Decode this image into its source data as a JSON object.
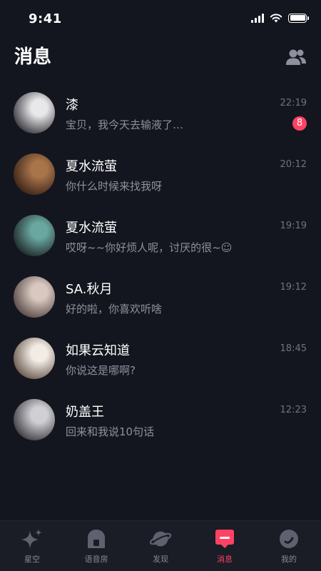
{
  "status": {
    "time": "9:41"
  },
  "header": {
    "title": "消息",
    "contacts_icon": "people-icon"
  },
  "chats": [
    {
      "name": "漆",
      "preview": "宝贝，我今天去输液了…",
      "time": "22:19",
      "unread": "8",
      "avatar_colors": [
        "#e8e8ea",
        "#3a3a40"
      ]
    },
    {
      "name": "夏水流萤",
      "preview": "你什么时候来找我呀",
      "time": "20:12",
      "avatar_colors": [
        "#a8744a",
        "#3c2418"
      ]
    },
    {
      "name": "夏水流萤",
      "preview": "哎呀~~你好烦人呢，讨厌的很~☺",
      "time": "19:19",
      "avatar_colors": [
        "#6aa7a0",
        "#1f2a2a"
      ]
    },
    {
      "name": "SA.秋月",
      "preview": "好的啦，你喜欢听啥",
      "time": "19:12",
      "avatar_colors": [
        "#d8c8c0",
        "#5a4a48"
      ]
    },
    {
      "name": "如果云知道",
      "preview": "你说这是哪啊?",
      "time": "18:45",
      "avatar_colors": [
        "#f2ece4",
        "#6b5a50"
      ]
    },
    {
      "name": "奶盖王",
      "preview": "回来和我说10句话",
      "time": "12:23",
      "avatar_colors": [
        "#d0d0d4",
        "#3e3e44"
      ]
    }
  ],
  "tabs": [
    {
      "label": "星空",
      "icon": "sparkle-icon",
      "active": false
    },
    {
      "label": "语音房",
      "icon": "voice-room-icon",
      "active": false
    },
    {
      "label": "发现",
      "icon": "planet-icon",
      "active": false
    },
    {
      "label": "消息",
      "icon": "message-icon",
      "active": true
    },
    {
      "label": "我的",
      "icon": "profile-icon",
      "active": false
    }
  ],
  "colors": {
    "accent": "#ff4263",
    "background": "#14161f",
    "tab_inactive": "#5f626e"
  }
}
